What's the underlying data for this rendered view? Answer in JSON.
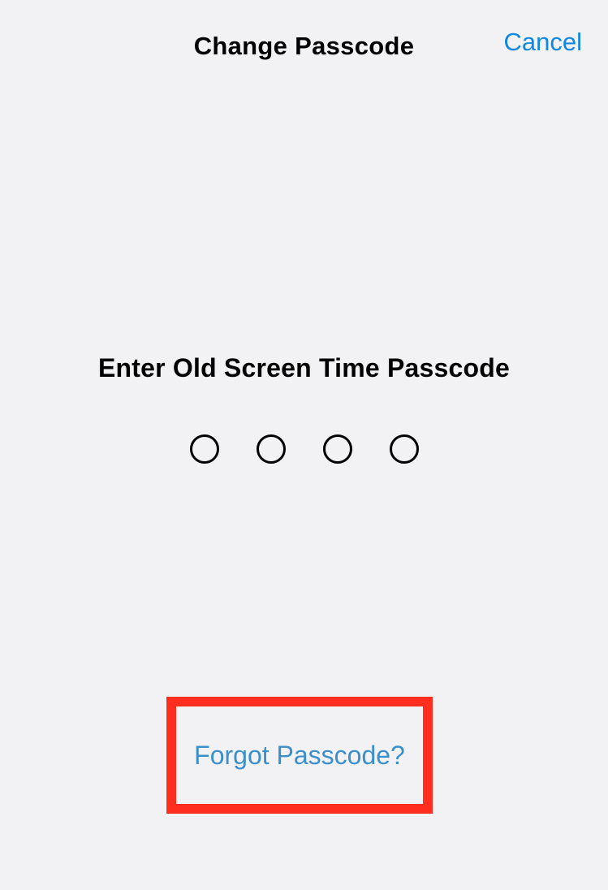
{
  "header": {
    "title": "Change Passcode",
    "cancel_label": "Cancel"
  },
  "main": {
    "prompt": "Enter Old Screen Time Passcode",
    "passcode_length": 4,
    "forgot_label": "Forgot Passcode?"
  }
}
